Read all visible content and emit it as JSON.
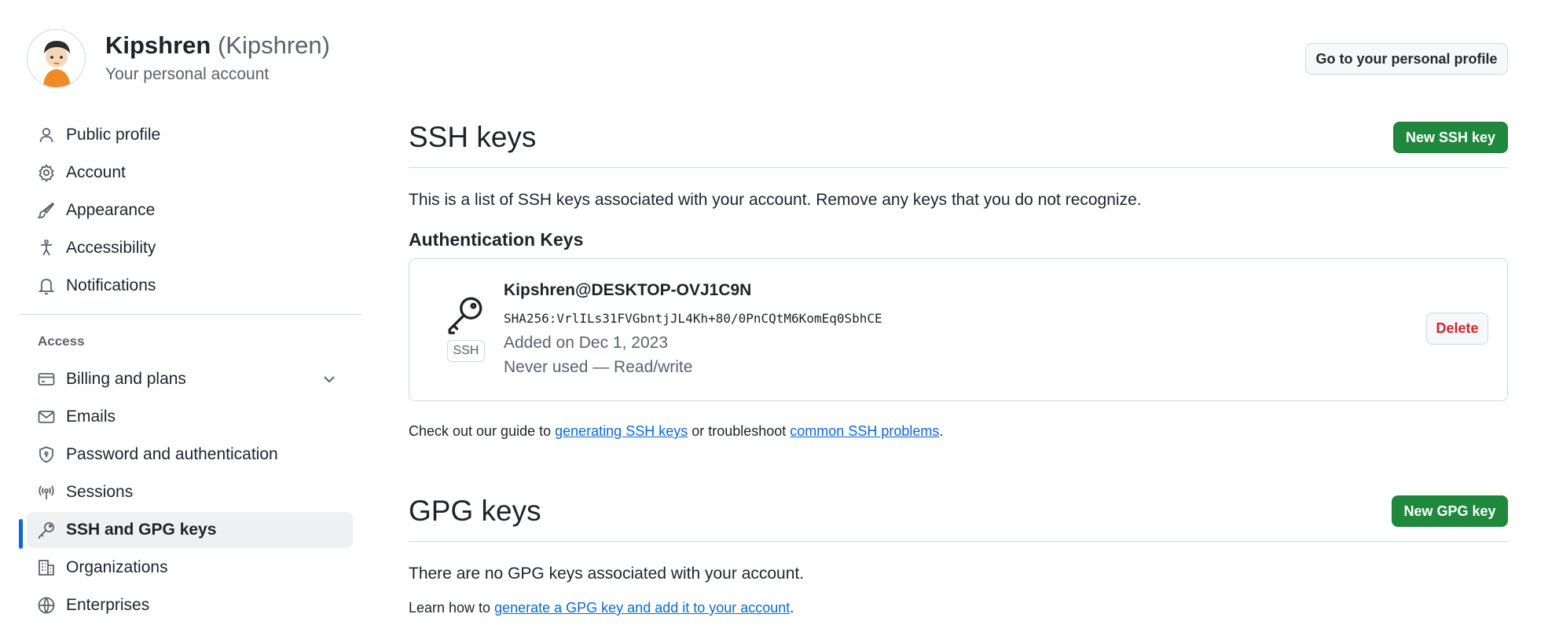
{
  "header": {
    "display_name": "Kipshren",
    "login": "(Kipshren)",
    "subtitle": "Your personal account",
    "profile_button": "Go to your personal profile"
  },
  "sidebar": {
    "items": [
      {
        "label": "Public profile",
        "icon": "person-icon"
      },
      {
        "label": "Account",
        "icon": "gear-icon"
      },
      {
        "label": "Appearance",
        "icon": "paintbrush-icon"
      },
      {
        "label": "Accessibility",
        "icon": "accessibility-icon"
      },
      {
        "label": "Notifications",
        "icon": "bell-icon"
      }
    ],
    "group_label": "Access",
    "access_items": [
      {
        "label": "Billing and plans",
        "icon": "credit-card-icon"
      },
      {
        "label": "Emails",
        "icon": "mail-icon"
      },
      {
        "label": "Password and authentication",
        "icon": "shield-lock-icon"
      },
      {
        "label": "Sessions",
        "icon": "broadcast-icon"
      },
      {
        "label": "SSH and GPG keys",
        "icon": "key-icon"
      },
      {
        "label": "Organizations",
        "icon": "organization-icon"
      },
      {
        "label": "Enterprises",
        "icon": "globe-icon"
      }
    ],
    "active_item": "SSH and GPG keys"
  },
  "ssh": {
    "title": "SSH keys",
    "new_button": "New SSH key",
    "description": "This is a list of SSH keys associated with your account. Remove any keys that you do not recognize.",
    "section_title": "Authentication Keys",
    "key": {
      "type_label": "SSH",
      "name": "Kipshren@DESKTOP-OVJ1C9N",
      "fingerprint": "SHA256:VrlILs31FVGbntjJL4Kh+80/0PnCQtM6KomEq0SbhCE",
      "added": "Added on Dec 1, 2023",
      "usage": "Never used — Read/write",
      "delete_button": "Delete"
    },
    "guide": {
      "prefix": "Check out our guide to ",
      "link1": "generating SSH keys",
      "middle": " or troubleshoot ",
      "link2": "common SSH problems",
      "suffix": "."
    }
  },
  "gpg": {
    "title": "GPG keys",
    "new_button": "New GPG key",
    "empty_text": "There are no GPG keys associated with your account.",
    "learn": {
      "prefix": "Learn how to ",
      "link": "generate a GPG key and add it to your account",
      "suffix": "."
    }
  },
  "colors": {
    "primary_green": "#1f883d",
    "active_accent": "#0969da",
    "danger": "#d1242f",
    "link": "#0969da"
  }
}
